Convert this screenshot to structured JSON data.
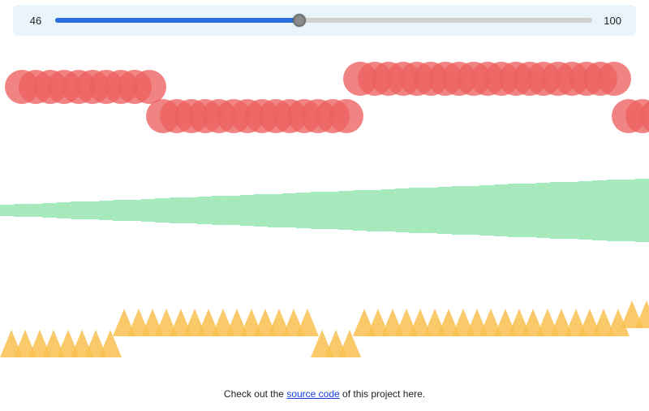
{
  "slider": {
    "value_label": "46",
    "max_label": "100",
    "value": 46,
    "min": 1,
    "max": 100
  },
  "shapes": {
    "count": 46,
    "colors": {
      "circle": "rgba(237,96,96,0.78)",
      "bar": "rgba(144,226,170,0.78)",
      "triangle": "rgba(248,192,82,0.86)"
    },
    "circle_y_offsets": [
      0,
      0,
      0,
      0,
      0,
      0,
      0,
      0,
      0,
      0,
      36,
      36,
      36,
      36,
      36,
      36,
      36,
      36,
      36,
      36,
      36,
      36,
      36,
      36,
      -10,
      -10,
      -10,
      -10,
      -10,
      -10,
      -10,
      -10,
      -10,
      -10,
      -10,
      -10,
      -10,
      -10,
      -10,
      -10,
      -10,
      -10,
      -10,
      36,
      36,
      36
    ],
    "triangle_y_offsets": [
      26,
      26,
      26,
      26,
      26,
      26,
      26,
      26,
      0,
      0,
      0,
      0,
      0,
      0,
      0,
      0,
      0,
      0,
      0,
      0,
      0,
      0,
      26,
      26,
      26,
      0,
      0,
      0,
      0,
      0,
      0,
      0,
      0,
      0,
      0,
      0,
      0,
      0,
      0,
      0,
      0,
      0,
      0,
      0,
      -10,
      -10
    ]
  },
  "footer": {
    "prefix": "Check out the ",
    "link_text": "source code",
    "suffix": " of this project here."
  }
}
